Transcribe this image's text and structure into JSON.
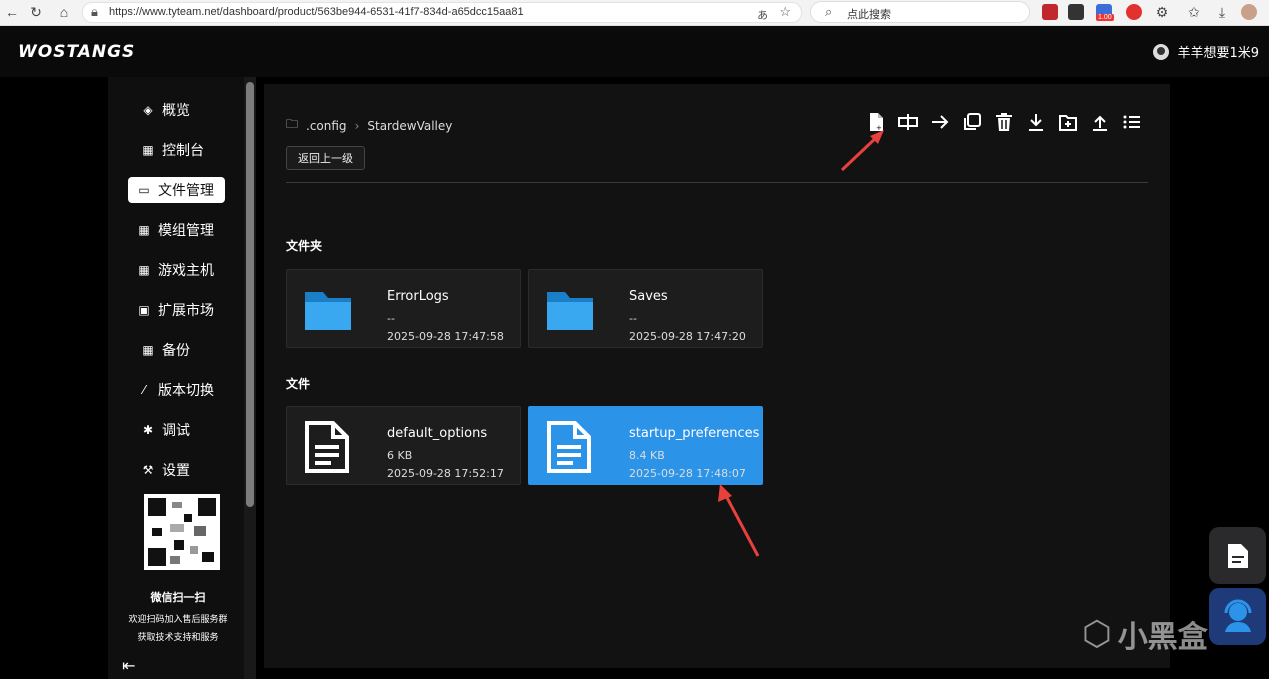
{
  "browser": {
    "url": "https://www.tyteam.net/dashboard/product/563be944-6531-41f7-834d-a65dcc15aa81",
    "search_placeholder": "点此搜索",
    "ext_badge": "1.00"
  },
  "header": {
    "logo": "WOSTANGS",
    "username": "羊羊想要1米9"
  },
  "sidebar": {
    "items": [
      {
        "label": "概览",
        "icon": "layers-icon"
      },
      {
        "label": "控制台",
        "icon": "grid-icon"
      },
      {
        "label": "文件管理",
        "icon": "folder-icon"
      },
      {
        "label": "模组管理",
        "icon": "grid-icon"
      },
      {
        "label": "游戏主机",
        "icon": "grid-icon"
      },
      {
        "label": "扩展市场",
        "icon": "bag-icon"
      },
      {
        "label": "备份",
        "icon": "grid-icon"
      },
      {
        "label": "版本切换",
        "icon": "pin-icon"
      },
      {
        "label": "调试",
        "icon": "bug-icon"
      },
      {
        "label": "设置",
        "icon": "wrench-icon"
      }
    ],
    "active_index": 2,
    "qr_title": "微信扫一扫",
    "qr_line1": "欢迎扫码加入售后服务群",
    "qr_line2": "获取技术支持和服务"
  },
  "main": {
    "breadcrumb": [
      ".config",
      "StardewValley"
    ],
    "back_label": "返回上一级",
    "toolbar": [
      "new-file-icon",
      "rename-icon",
      "move-icon",
      "copy-icon",
      "delete-icon",
      "download-icon",
      "new-folder-icon",
      "upload-icon",
      "list-view-icon"
    ],
    "folders_title": "文件夹",
    "files_title": "文件",
    "folders": [
      {
        "name": "ErrorLogs",
        "size": "--",
        "date": "2025-09-28 17:47:58"
      },
      {
        "name": "Saves",
        "size": "--",
        "date": "2025-09-28 17:47:20"
      }
    ],
    "files": [
      {
        "name": "default_options",
        "size": "6 KB",
        "date": "2025-09-28 17:52:17",
        "selected": false
      },
      {
        "name": "startup_preferences",
        "size": "8.4 KB",
        "date": "2025-09-28 17:48:07",
        "selected": true
      }
    ]
  },
  "watermark": "小黑盒",
  "colors": {
    "accent": "#2b93e8",
    "folder": "#3aa8f0",
    "arrow": "#e8413c"
  }
}
